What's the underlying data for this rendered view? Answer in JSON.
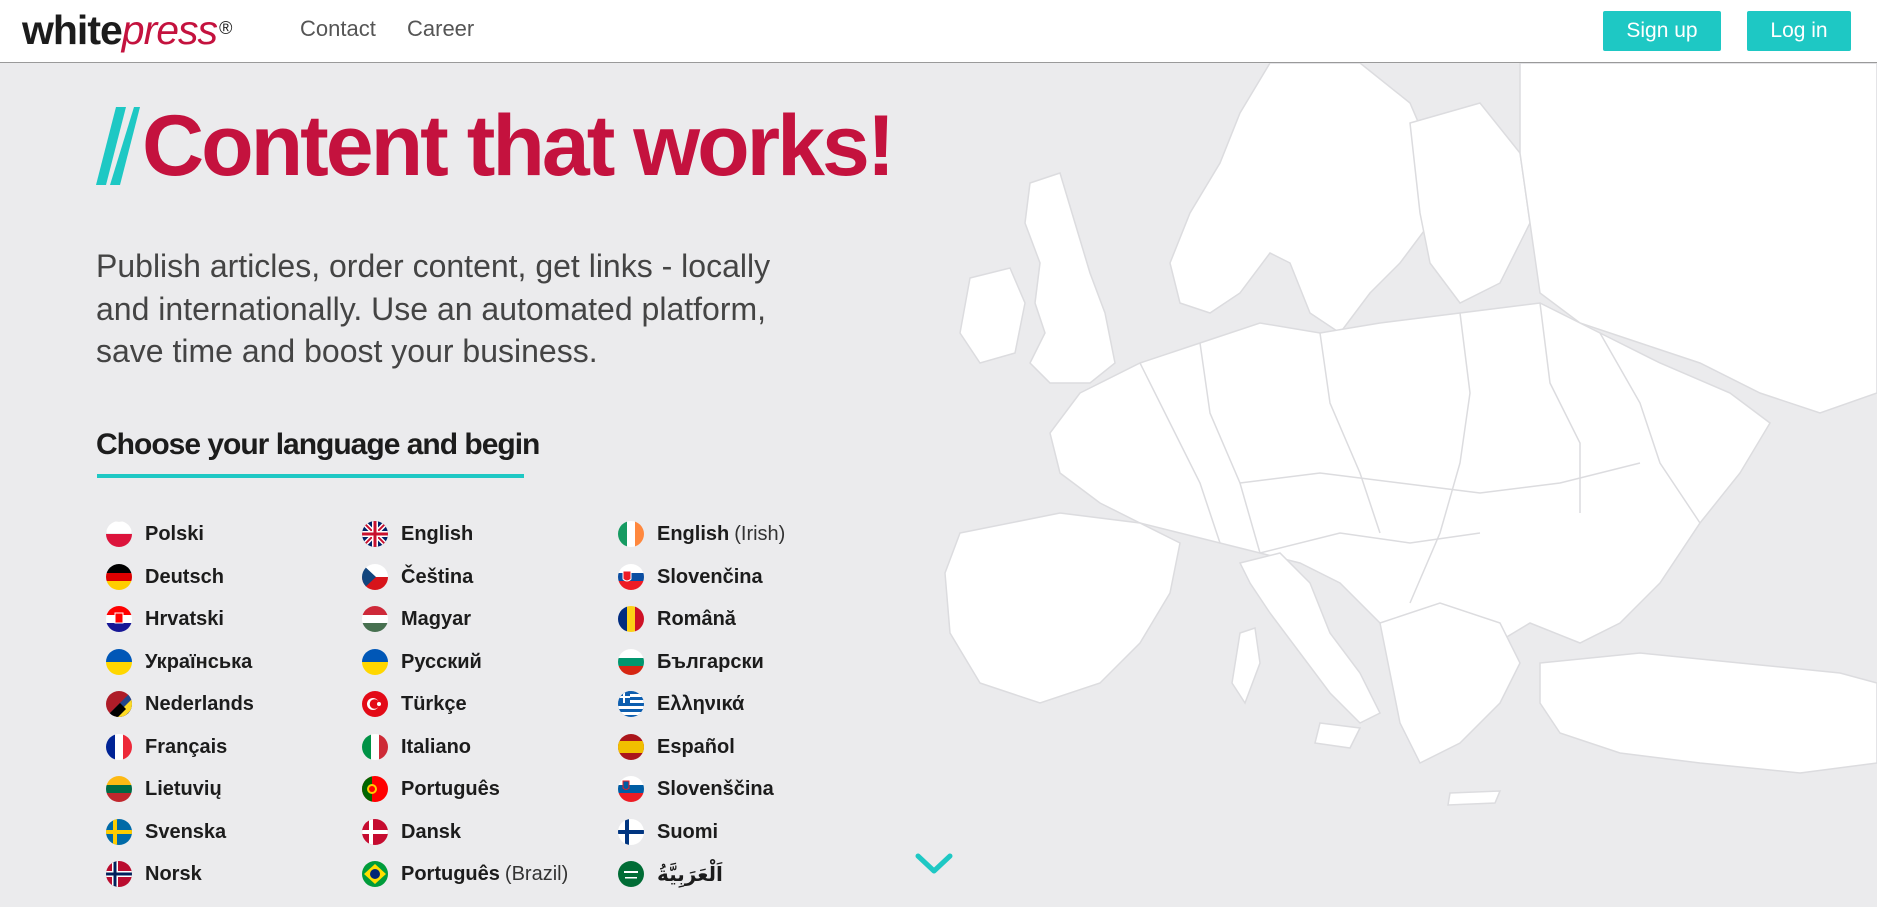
{
  "header": {
    "logo_main": "white",
    "logo_accent": "press",
    "logo_mark": "®",
    "nav": [
      "Contact",
      "Career"
    ],
    "signup_label": "Sign up",
    "login_label": "Log in"
  },
  "hero": {
    "title": "Content that works!",
    "subtitle": "Publish articles, order content, get links - locally and internationally. Use an automated platform, save time and boost your business.",
    "choose_heading": "Choose your language and begin"
  },
  "languages": [
    {
      "label": "Polski",
      "icon": "pl-flag-icon"
    },
    {
      "label": "English",
      "icon": "gb-flag-icon"
    },
    {
      "label": "English",
      "extra": "(Irish)",
      "icon": "ie-flag-icon"
    },
    {
      "label": "Deutsch",
      "icon": "de-flag-icon"
    },
    {
      "label": "Čeština",
      "icon": "cz-flag-icon"
    },
    {
      "label": "Slovenčina",
      "icon": "sk-flag-icon"
    },
    {
      "label": "Hrvatski",
      "icon": "hr-flag-icon"
    },
    {
      "label": "Magyar",
      "icon": "hu-flag-icon"
    },
    {
      "label": "Română",
      "icon": "ro-flag-icon"
    },
    {
      "label": "Українська",
      "icon": "ua-flag-icon"
    },
    {
      "label": "Русский",
      "icon": "ua-flag-icon"
    },
    {
      "label": "Български",
      "icon": "bg-flag-icon"
    },
    {
      "label": "Nederlands",
      "icon": "be-nl-flag-icon"
    },
    {
      "label": "Türkçe",
      "icon": "tr-flag-icon"
    },
    {
      "label": "Ελληνικά",
      "icon": "gr-flag-icon"
    },
    {
      "label": "Français",
      "icon": "fr-flag-icon"
    },
    {
      "label": "Italiano",
      "icon": "it-flag-icon"
    },
    {
      "label": "Español",
      "icon": "es-flag-icon"
    },
    {
      "label": "Lietuvių",
      "icon": "lt-flag-icon"
    },
    {
      "label": "Português",
      "icon": "pt-flag-icon"
    },
    {
      "label": "Slovenščina",
      "icon": "si-flag-icon"
    },
    {
      "label": "Svenska",
      "icon": "se-flag-icon"
    },
    {
      "label": "Dansk",
      "icon": "dk-flag-icon"
    },
    {
      "label": "Suomi",
      "icon": "fi-flag-icon"
    },
    {
      "label": "Norsk",
      "icon": "no-flag-icon"
    },
    {
      "label": "Português",
      "extra": "(Brazil)",
      "icon": "br-flag-icon"
    },
    {
      "label": "اَلْعَرَبِيَّةُ",
      "icon": "sa-flag-icon"
    }
  ],
  "colors": {
    "brand_red": "#c4123e",
    "accent_teal": "#1ec8c4",
    "background": "#ebebed"
  },
  "icons": {
    "scroll_down": "chevron-down-icon",
    "map": "europe-map-icon"
  }
}
